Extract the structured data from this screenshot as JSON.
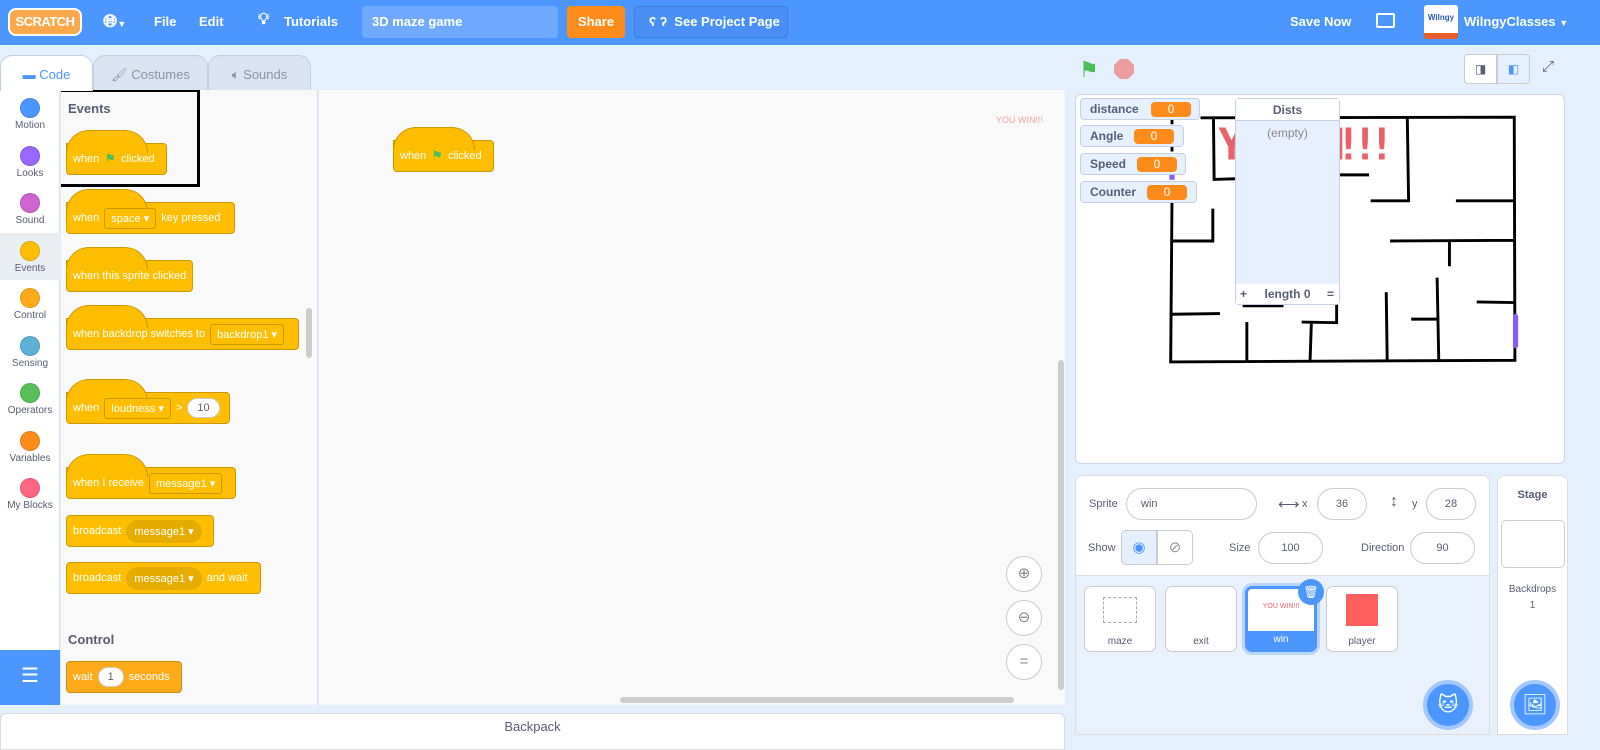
{
  "menu": {
    "logo": "SCRATCH",
    "file": "File",
    "edit": "Edit",
    "tutorials": "Tutorials",
    "project_title": "3D maze game",
    "share": "Share",
    "see_project_page": "See Project Page",
    "save_now": "Save Now",
    "username": "WilngyClasses",
    "avatar_text": "Wilngy"
  },
  "tabs": [
    {
      "label": "Code"
    },
    {
      "label": "Costumes"
    },
    {
      "label": "Sounds"
    }
  ],
  "categories": [
    {
      "label": "Motion",
      "color": "#4c97ff"
    },
    {
      "label": "Looks",
      "color": "#9966ff"
    },
    {
      "label": "Sound",
      "color": "#cf63cf"
    },
    {
      "label": "Events",
      "color": "#ffbf00"
    },
    {
      "label": "Control",
      "color": "#ffab19"
    },
    {
      "label": "Sensing",
      "color": "#5cb1d6"
    },
    {
      "label": "Operators",
      "color": "#59c059"
    },
    {
      "label": "Variables",
      "color": "#ff8c1a"
    },
    {
      "label": "My Blocks",
      "color": "#ff6680"
    }
  ],
  "palette": {
    "events_heading": "Events",
    "flag_block": {
      "a": "when",
      "b": "clicked"
    },
    "key_block": {
      "a": "when",
      "key": "space",
      "b": "key pressed"
    },
    "sprite_clicked": "when this sprite clicked",
    "backdrop_block": {
      "a": "when backdrop switches to",
      "backdrop": "backdrop1"
    },
    "loudness_block": {
      "a": "when",
      "sensor": "loudness",
      "op": ">",
      "value": "10"
    },
    "receive_block": {
      "a": "when I receive",
      "msg": "message1"
    },
    "broadcast_block": {
      "a": "broadcast",
      "msg": "message1"
    },
    "broadcast_wait_block": {
      "a": "broadcast",
      "msg": "message1",
      "b": "and wait"
    },
    "control_heading": "Control",
    "wait_block": {
      "a": "wait",
      "value": "1",
      "b": "seconds"
    }
  },
  "script": {
    "flag_block": {
      "a": "when",
      "b": "clicked"
    },
    "sprite_preview": "YOU WIN!!!"
  },
  "backpack": "Backpack",
  "stage": {
    "monitors": [
      {
        "label": "distance",
        "value": "0"
      },
      {
        "label": "Angle",
        "value": "0"
      },
      {
        "label": "Speed",
        "value": "0"
      },
      {
        "label": "Counter",
        "value": "0"
      }
    ],
    "list": {
      "title": "Dists",
      "empty": "(empty)",
      "add": "+",
      "length": "length 0",
      "resize": "="
    },
    "win_text": "YOU WIN!!!"
  },
  "sprite_info": {
    "sprite_label": "Sprite",
    "name": "win",
    "x_label": "x",
    "x": "36",
    "y_label": "y",
    "y": "28",
    "show_label": "Show",
    "size_label": "Size",
    "size": "100",
    "direction_label": "Direction",
    "direction": "90"
  },
  "sprites": [
    {
      "name": "maze"
    },
    {
      "name": "exit"
    },
    {
      "name": "win",
      "selected": true
    },
    {
      "name": "player"
    }
  ],
  "stage_panel": {
    "label": "Stage",
    "backdrops_label": "Backdrops",
    "backdrops_count": "1"
  }
}
